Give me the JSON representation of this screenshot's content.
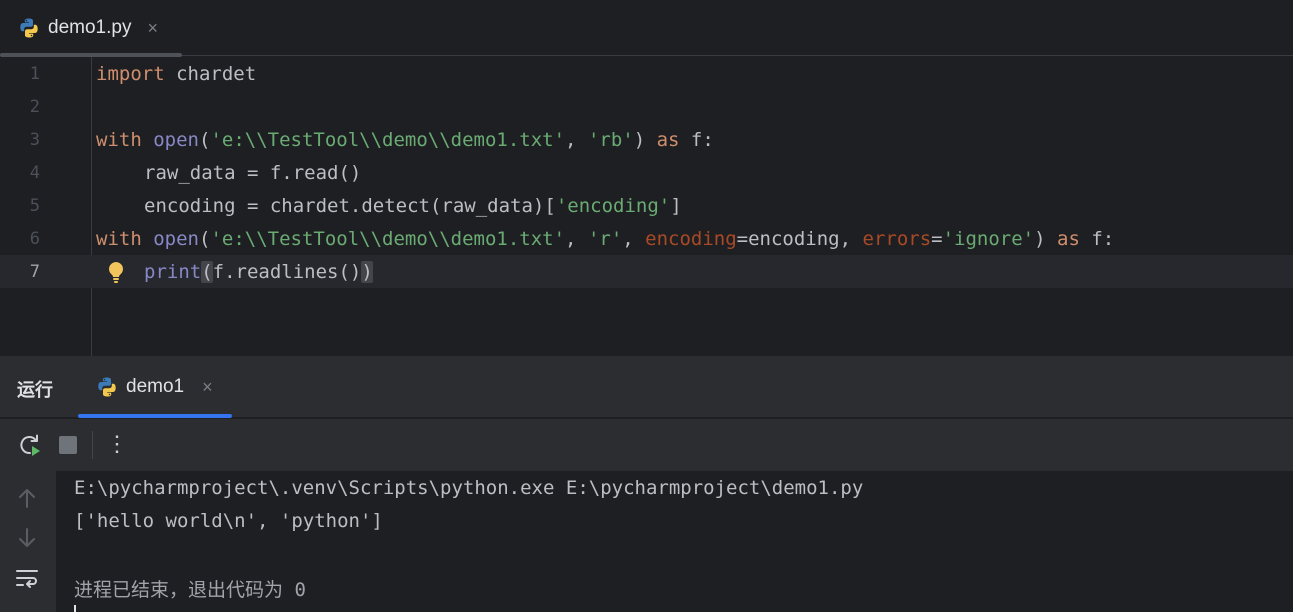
{
  "editor_tab": {
    "label": "demo1.py",
    "close": "×"
  },
  "code": {
    "line_numbers": [
      "1",
      "2",
      "3",
      "4",
      "5",
      "6",
      "7"
    ],
    "l1": {
      "kw": "import",
      "rest": " chardet"
    },
    "l3": {
      "kw1": "with",
      "sp1": " ",
      "fn": "open",
      "p1": "(",
      "s1": "'e:\\\\TestTool\\\\demo\\\\demo1.txt'",
      "c1": ", ",
      "s2": "'rb'",
      "p2": ") ",
      "kw2": "as",
      "rest": " f:"
    },
    "l4": {
      "text": "raw_data = f.read()"
    },
    "l5": {
      "a": "encoding = chardet.detect(raw_data)[",
      "s": "'encoding'",
      "b": "]"
    },
    "l6": {
      "kw1": "with",
      "sp1": " ",
      "fn": "open",
      "p1": "(",
      "s1": "'e:\\\\TestTool\\\\demo\\\\demo1.txt'",
      "c1": ", ",
      "s2": "'r'",
      "c2": ", ",
      "par1": "encoding",
      "eq1": "=encoding, ",
      "par2": "errors",
      "eq2": "=",
      "s3": "'ignore'",
      "p2": ") ",
      "kw2": "as",
      "rest": " f:"
    },
    "l7": {
      "fn": "print",
      "open": "(",
      "mid": "f.readlines()",
      "close": ")"
    }
  },
  "run_panel": {
    "title": "运行",
    "tab_label": "demo1",
    "tab_close": "×",
    "toolbar": {
      "more": "⋮"
    }
  },
  "console": {
    "lines": [
      "E:\\pycharmproject\\.venv\\Scripts\\python.exe E:\\pycharmproject\\demo1.py",
      "['hello world\\n', 'python']",
      "",
      "进程已结束，退出代码为 0"
    ]
  },
  "colors": {
    "background": "#1e1f22",
    "panel": "#2b2d30",
    "keyword": "#cf8e6d",
    "builtin": "#8888c6",
    "string": "#6aab73",
    "parameter": "#aa4926",
    "accent": "#3574f0"
  },
  "icons": [
    "python-icon",
    "close-icon",
    "lightbulb-icon",
    "rerun-icon",
    "stop-icon",
    "more-icon",
    "arrow-up-icon",
    "arrow-down-icon",
    "soft-wrap-icon"
  ]
}
